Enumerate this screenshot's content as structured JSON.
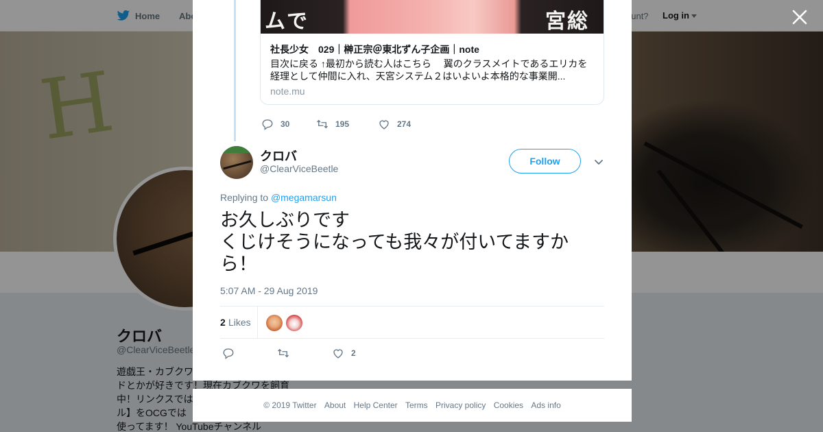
{
  "background_page": {
    "nav": {
      "home": "Home",
      "about": "Abo",
      "have_account": "ccount?",
      "login": "Log in"
    },
    "profile": {
      "name": "クロバ",
      "handle": "@ClearViceBeetle",
      "bio_lines": [
        "遊戯王・カブクワ",
        "ドとかが好きです！現在カブクワを飼育",
        "中！リンクスでは",
        "ル】をOCGでは",
        "使ってます！ YouTubeチャンネル"
      ]
    }
  },
  "modal": {
    "link_card": {
      "image_text_left": "ムで",
      "image_text_right": "宮総",
      "title": "社長少女　029｜榊正宗＠東北ずん子企画｜note",
      "description": "目次に戻る ↑最初から読む人はこちら　 翼のクラスメイトであるエリカを経理として仲間に入れ、天宮システム２はいよいよ本格的な事業開...",
      "domain": "note.mu"
    },
    "parent_actions": {
      "replies": "30",
      "retweets": "195",
      "likes": "274"
    },
    "tweet": {
      "author_name": "クロバ",
      "author_handle": "@ClearViceBeetle",
      "follow_label": "Follow",
      "replying_to_label": "Replying to",
      "replying_to_handle": "@megamarsun",
      "text_lines": [
        "お久しぶりです",
        "くじけそうになっても我々が付いてますか",
        "ら！"
      ],
      "timestamp": "5:07 AM - 29 Aug 2019",
      "likes_count": "2",
      "likes_label": "Likes",
      "action_likes": "2"
    }
  },
  "footer": {
    "links": [
      "© 2019 Twitter",
      "About",
      "Help Center",
      "Terms",
      "Privacy policy",
      "Cookies",
      "Ads info"
    ]
  },
  "colors": {
    "accent": "#1da1f2",
    "secondary_text": "#657786",
    "thread_line": "#c4e2f7"
  }
}
